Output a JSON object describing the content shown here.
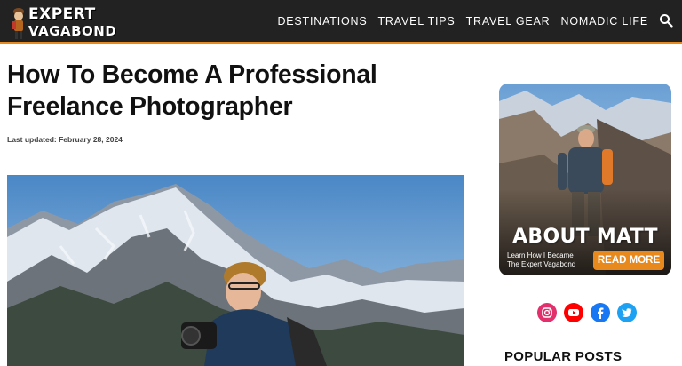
{
  "brand": {
    "line1": "EXPERT",
    "line2": "VAGABOND"
  },
  "nav": [
    "DESTINATIONS",
    "TRAVEL TIPS",
    "TRAVEL GEAR",
    "NOMADIC LIFE"
  ],
  "article": {
    "title": "How To Become A Professional Freelance Photographer",
    "updated": "Last updated: February 28, 2024"
  },
  "about": {
    "title": "ABOUT MATT",
    "subtitle_1": "Learn How I Became",
    "subtitle_2": "The Expert Vagabond",
    "button": "READ MORE"
  },
  "social": [
    {
      "icon": "instagram-icon",
      "color": "#e1306c"
    },
    {
      "icon": "youtube-icon",
      "color": "#ff0000"
    },
    {
      "icon": "facebook-icon",
      "color": "#1877f2"
    },
    {
      "icon": "twitter-icon",
      "color": "#1da1f2"
    }
  ],
  "sidebar": {
    "popular_heading": "POPULAR POSTS"
  },
  "colors": {
    "header": "#222222",
    "accent": "#e8891e"
  }
}
